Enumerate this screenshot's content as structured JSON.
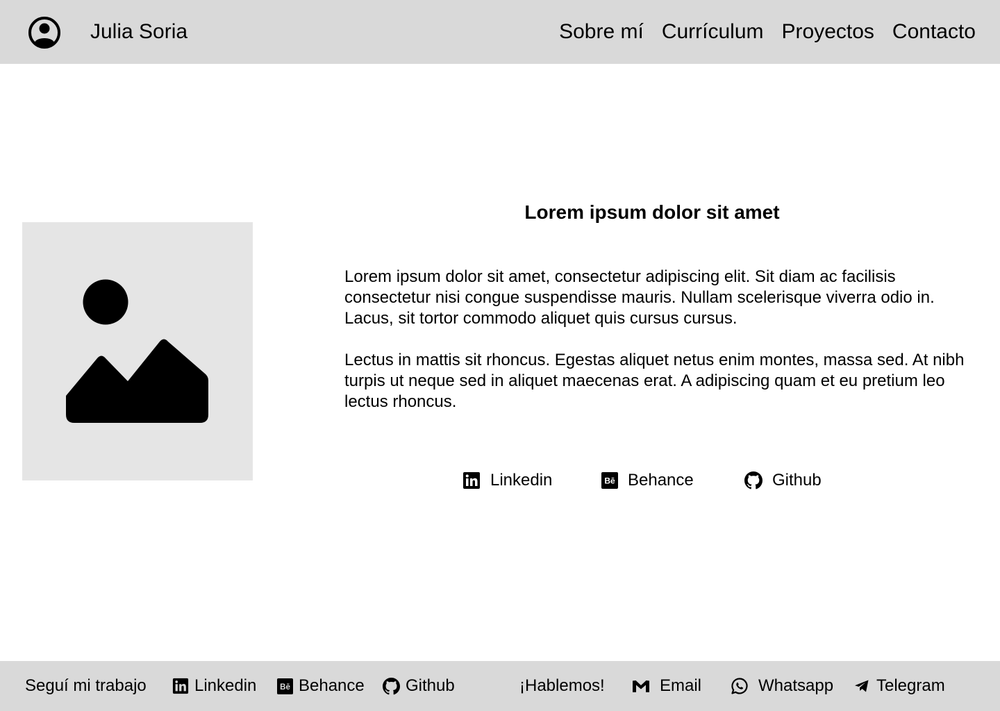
{
  "header": {
    "brand": "Julia Soria",
    "avatar_icon": "user-circle-icon",
    "nav": [
      {
        "label": "Sobre mí"
      },
      {
        "label": "Currículum"
      },
      {
        "label": "Proyectos"
      },
      {
        "label": "Contacto"
      }
    ]
  },
  "hero": {
    "image_icon": "image-placeholder-icon",
    "title": "Lorem ipsum dolor sit amet",
    "paragraphs": [
      "Lorem ipsum dolor sit amet, consectetur adipiscing elit. Sit diam ac facilisis consectetur nisi congue suspendisse mauris. Nullam scelerisque viverra odio in. Lacus, sit tortor commodo aliquet quis cursus cursus.",
      "Lectus in mattis sit rhoncus. Egestas aliquet netus enim montes, massa sed. At nibh turpis ut neque sed in aliquet maecenas erat. A adipiscing quam et eu pretium leo lectus rhoncus."
    ],
    "social": [
      {
        "label": "Linkedin",
        "icon": "linkedin-icon"
      },
      {
        "label": "Behance",
        "icon": "behance-icon"
      },
      {
        "label": "Github",
        "icon": "github-icon"
      }
    ]
  },
  "footer": {
    "work_label": "Seguí mi trabajo",
    "work_links": [
      {
        "label": "Linkedin",
        "icon": "linkedin-icon"
      },
      {
        "label": "Behance",
        "icon": "behance-icon"
      },
      {
        "label": "Github",
        "icon": "github-icon"
      }
    ],
    "contact_label": "¡Hablemos!",
    "contact_links": [
      {
        "label": "Email",
        "icon": "gmail-icon"
      },
      {
        "label": "Whatsapp",
        "icon": "whatsapp-icon"
      },
      {
        "label": "Telegram",
        "icon": "telegram-icon"
      }
    ]
  }
}
